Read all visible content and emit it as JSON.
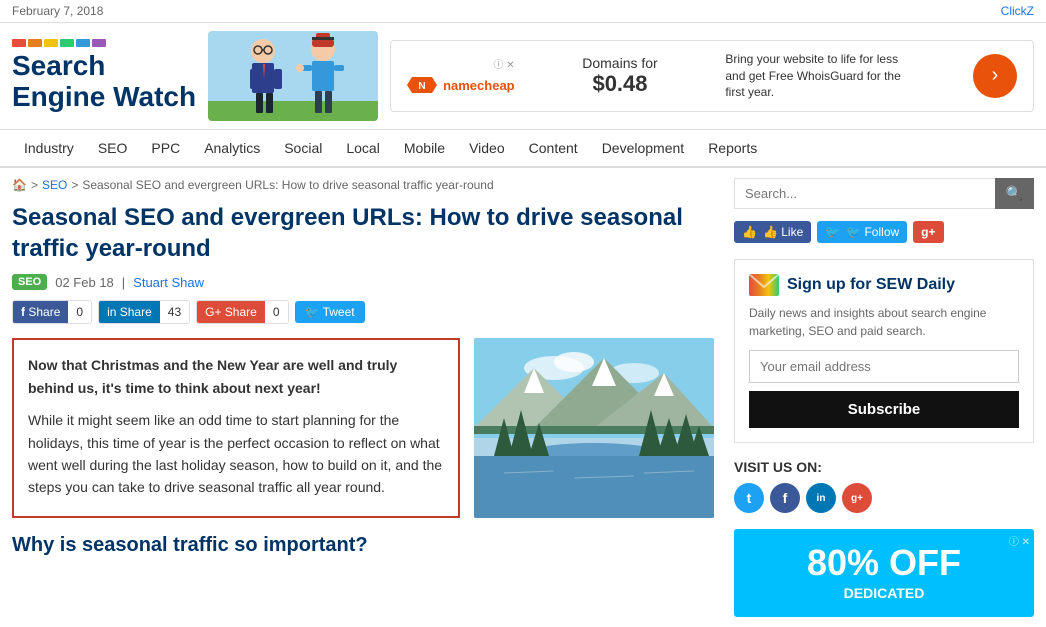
{
  "topbar": {
    "date": "February 7, 2018",
    "clickz_label": "ClickZ"
  },
  "header": {
    "logo_line1": "Search",
    "logo_line2": "Engine Watch",
    "color_bar": [
      "#e74c3c",
      "#e67e22",
      "#f1c40f",
      "#2ecc71",
      "#3498db",
      "#9b59b6"
    ],
    "ad": {
      "logo": "N namecheap",
      "price_line1": "Domains for",
      "price_line2": "$0.48",
      "description": "Bring your website to life for less and get Free WhoisGuard for the first year.",
      "cta": "›",
      "info": "ⓘ ✕"
    }
  },
  "nav": {
    "items": [
      {
        "label": "Industry",
        "href": "#"
      },
      {
        "label": "SEO",
        "href": "#"
      },
      {
        "label": "PPC",
        "href": "#"
      },
      {
        "label": "Analytics",
        "href": "#"
      },
      {
        "label": "Social",
        "href": "#"
      },
      {
        "label": "Local",
        "href": "#"
      },
      {
        "label": "Mobile",
        "href": "#"
      },
      {
        "label": "Video",
        "href": "#"
      },
      {
        "label": "Content",
        "href": "#"
      },
      {
        "label": "Development",
        "href": "#"
      },
      {
        "label": "Reports",
        "href": "#"
      }
    ]
  },
  "breadcrumb": {
    "home": "🏠",
    "sep1": ">",
    "seo": "SEO",
    "sep2": ">",
    "current": "Seasonal SEO and evergreen URLs: How to drive seasonal traffic year-round"
  },
  "article": {
    "title": "Seasonal SEO and evergreen URLs: How to drive seasonal traffic year-round",
    "badge": "SEO",
    "date": "02 Feb 18",
    "separator": "|",
    "author": "Stuart Shaw",
    "social_share": {
      "fb_label": "Share",
      "fb_count": "0",
      "in_label": "in Share",
      "in_count": "43",
      "gplus_label": "G+ Share",
      "gplus_count": "0",
      "tweet_label": "Tweet"
    },
    "body_bold": "Now that Christmas and the New Year are well and truly behind us, it's time to think about next year!",
    "body_para": "While it might seem like an odd time to start planning for the holidays, this time of year is the perfect occasion to reflect on what went well during the last holiday season, how to build on it, and the steps you can take to drive seasonal traffic all year round.",
    "section_heading": "Why is seasonal traffic so important?"
  },
  "sidebar": {
    "search_placeholder": "Search...",
    "search_btn": "🔍",
    "like_label": "👍 Like",
    "follow_label": "🐦 Follow",
    "gplus_label": "g+",
    "newsletter": {
      "title": "Sign up for SEW Daily",
      "description": "Daily news and insights about search engine marketing, SEO and paid search.",
      "email_placeholder": "Your email address",
      "subscribe_btn": "Subscribe"
    },
    "visit_us": {
      "label": "VISIT US ON:",
      "icons": [
        {
          "name": "twitter",
          "color": "#1da1f2",
          "letter": "t"
        },
        {
          "name": "facebook",
          "color": "#3b5998",
          "letter": "f"
        },
        {
          "name": "linkedin",
          "color": "#0077b5",
          "letter": "in"
        },
        {
          "name": "googleplus",
          "color": "#dd4b39",
          "letter": "g+"
        }
      ]
    },
    "ad": {
      "discount": "80% OFF",
      "label": "DEDICATED"
    }
  }
}
